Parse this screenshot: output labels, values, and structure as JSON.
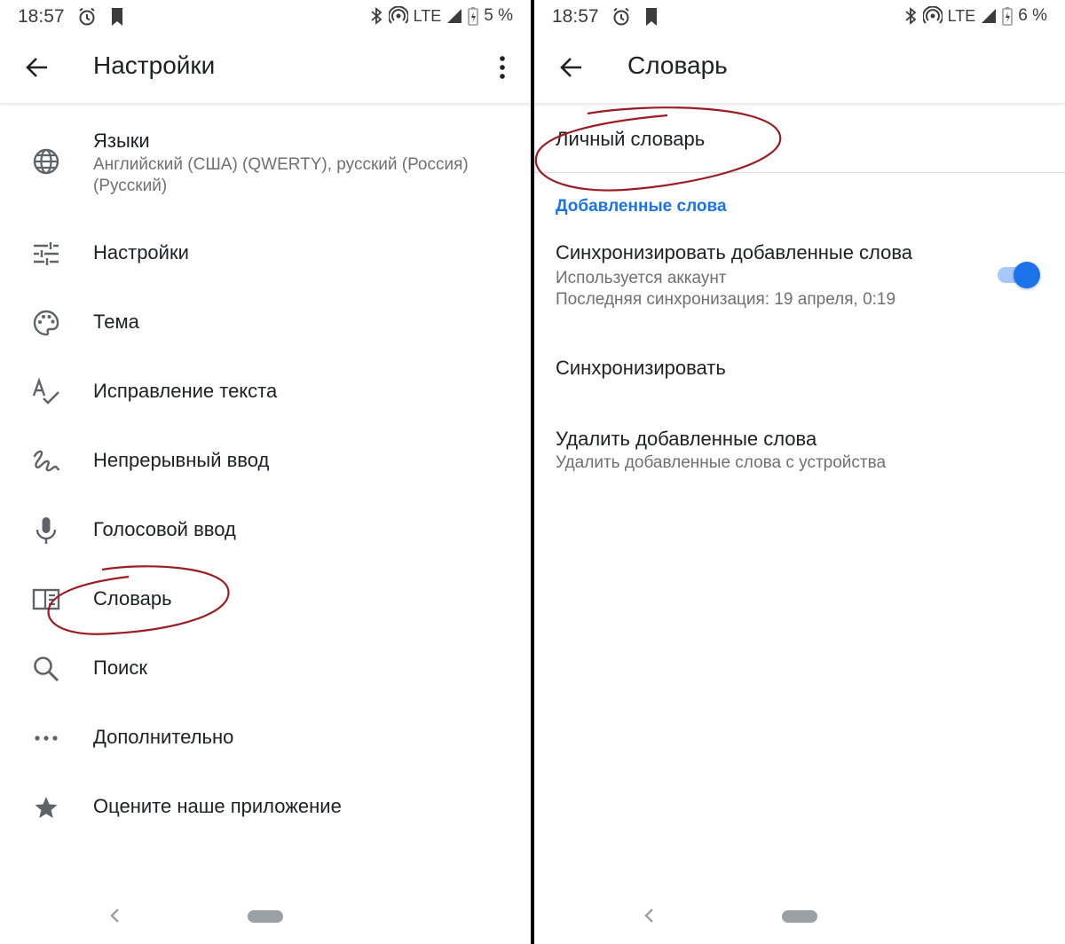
{
  "left": {
    "status": {
      "time": "18:57",
      "network": "LTE",
      "battery": "5 %"
    },
    "appbar": {
      "title": "Настройки"
    },
    "items": [
      {
        "title": "Языки",
        "subtitle": "Английский (США) (QWERTY), русский (Россия) (Русский)",
        "icon": "globe-icon"
      },
      {
        "title": "Настройки",
        "icon": "tune-icon"
      },
      {
        "title": "Тема",
        "icon": "palette-icon"
      },
      {
        "title": "Исправление текста",
        "icon": "spellcheck-icon"
      },
      {
        "title": "Непрерывный ввод",
        "icon": "gesture-icon"
      },
      {
        "title": "Голосовой ввод",
        "icon": "mic-icon"
      },
      {
        "title": "Словарь",
        "icon": "dictionary-icon"
      },
      {
        "title": "Поиск",
        "icon": "search-icon"
      },
      {
        "title": "Дополнительно",
        "icon": "more-horiz-icon"
      },
      {
        "title": "Оцените наше приложение",
        "icon": "star-icon"
      }
    ]
  },
  "right": {
    "status": {
      "time": "18:57",
      "network": "LTE",
      "battery": "6 %"
    },
    "appbar": {
      "title": "Словарь"
    },
    "personal_dictionary": "Личный словарь",
    "section_header": "Добавленные слова",
    "sync_added": {
      "title": "Синхронизировать добавленные слова",
      "subtitle1": "Используется аккаунт",
      "subtitle2": "Последняя синхронизация: 19 апреля, 0:19",
      "toggle_on": true
    },
    "sync_now": "Синхронизировать",
    "delete_words": {
      "title": "Удалить добавленные слова",
      "subtitle": "Удалить добавленные слова с устройства"
    }
  },
  "colors": {
    "accent": "#1a73e8",
    "annotation": "#9b1c22",
    "secondary_text": "#707070",
    "icon": "#5f6368"
  }
}
